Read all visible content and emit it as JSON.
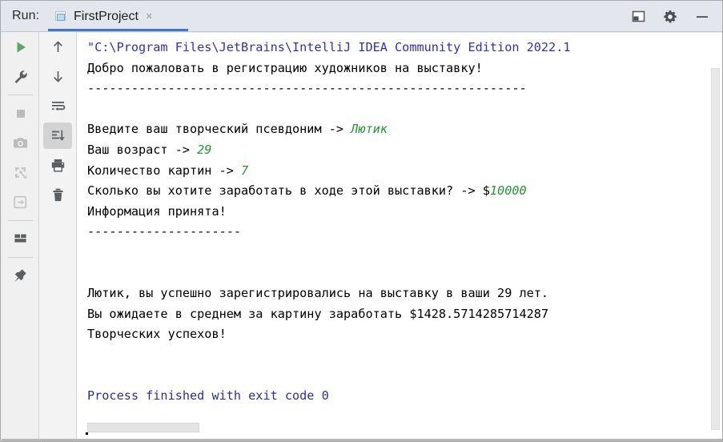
{
  "window": {
    "run_label": "Run:",
    "controls": [
      {
        "name": "layout-settings-icon",
        "label": "Layout Settings"
      },
      {
        "name": "gear-icon",
        "label": "Settings"
      },
      {
        "name": "minimize-icon",
        "label": "Hide"
      }
    ]
  },
  "tab": {
    "title": "FirstProject",
    "close_label": "×",
    "icon": "console-run-icon",
    "accent_color": "#3c77c9"
  },
  "toolbar_left": [
    {
      "name": "rerun-button",
      "icon": "play-icon",
      "label": "Rerun",
      "enabled": true
    },
    {
      "name": "edit-configurations-button",
      "icon": "wrench-icon",
      "label": "Modify Run Configuration",
      "enabled": true
    },
    {
      "name": "separator-1",
      "icon": "separator",
      "label": "",
      "enabled": false
    },
    {
      "name": "stop-button",
      "icon": "stop-square-icon",
      "label": "Stop",
      "enabled": false
    },
    {
      "name": "screenshot-button",
      "icon": "camera-icon",
      "label": "Capture Screenshot",
      "enabled": false
    },
    {
      "name": "dump-threads-button",
      "icon": "threads-icon",
      "label": "Dump Threads",
      "enabled": false
    },
    {
      "name": "attach-button",
      "icon": "attach-icon",
      "label": "Attach",
      "enabled": false
    },
    {
      "name": "separator-2",
      "icon": "separator",
      "label": "",
      "enabled": false
    },
    {
      "name": "layout-button",
      "icon": "layout-icon",
      "label": "Layout",
      "enabled": true
    },
    {
      "name": "separator-3",
      "icon": "separator",
      "label": "",
      "enabled": false
    },
    {
      "name": "pin-tab-button",
      "icon": "pin-icon",
      "label": "Pin Tab",
      "enabled": true
    }
  ],
  "toolbar_right": [
    {
      "name": "up-button",
      "icon": "arrow-up-icon",
      "label": "Up the Stack Trace",
      "enabled": true,
      "active": false
    },
    {
      "name": "down-button",
      "icon": "arrow-down-icon",
      "label": "Down the Stack Trace",
      "enabled": true,
      "active": false
    },
    {
      "name": "soft-wrap-button",
      "icon": "soft-wrap-icon",
      "label": "Soft-Wrap",
      "enabled": true,
      "active": false
    },
    {
      "name": "scroll-to-end-button",
      "icon": "scroll-to-end-icon",
      "label": "Scroll to the End",
      "enabled": true,
      "active": true
    },
    {
      "name": "print-button",
      "icon": "printer-icon",
      "label": "Print",
      "enabled": true,
      "active": false
    },
    {
      "name": "clear-all-button",
      "icon": "trash-icon",
      "label": "Clear All",
      "enabled": true,
      "active": false
    }
  ],
  "console": {
    "colors": {
      "command_path": "#2f2fbf",
      "user_input": "#1f9a33",
      "output": "#000000",
      "exit_message": "#2b2ba8"
    },
    "lines": [
      [
        {
          "text": "\"C:\\Program Files\\JetBrains\\IntelliJ IDEA Community Edition 2022.1",
          "style": "path"
        }
      ],
      [
        {
          "text": "Добро пожаловать в регистрацию художников на выставку!",
          "style": "plain"
        }
      ],
      [
        {
          "text": "------------------------------------------------------------",
          "style": "plain"
        }
      ],
      [
        {
          "text": "",
          "style": "plain"
        }
      ],
      [
        {
          "text": "Введите ваш творческий псевдоним -> ",
          "style": "plain"
        },
        {
          "text": "Лютик",
          "style": "input"
        }
      ],
      [
        {
          "text": "Ваш возраст -> ",
          "style": "plain"
        },
        {
          "text": "29",
          "style": "input"
        }
      ],
      [
        {
          "text": "Количество картин -> ",
          "style": "plain"
        },
        {
          "text": "7",
          "style": "input"
        }
      ],
      [
        {
          "text": "Сколько вы хотите заработать в ходе этой выставки? -> $",
          "style": "plain"
        },
        {
          "text": "10000",
          "style": "input"
        }
      ],
      [
        {
          "text": "Информация принята!",
          "style": "plain"
        }
      ],
      [
        {
          "text": "---------------------",
          "style": "plain"
        }
      ],
      [
        {
          "text": "",
          "style": "plain"
        }
      ],
      [
        {
          "text": "",
          "style": "plain"
        }
      ],
      [
        {
          "text": "Лютик, вы успешно зарегистрировались на выставку в ваши 29 лет.",
          "style": "plain"
        }
      ],
      [
        {
          "text": "Вы ожидаете в среднем за картину заработать $1428.5714285714287",
          "style": "plain"
        }
      ],
      [
        {
          "text": "Творческих успехов!",
          "style": "plain"
        }
      ],
      [
        {
          "text": "",
          "style": "plain"
        }
      ],
      [
        {
          "text": "",
          "style": "plain"
        }
      ],
      [
        {
          "text": "Process finished with exit code 0",
          "style": "link"
        }
      ]
    ]
  }
}
